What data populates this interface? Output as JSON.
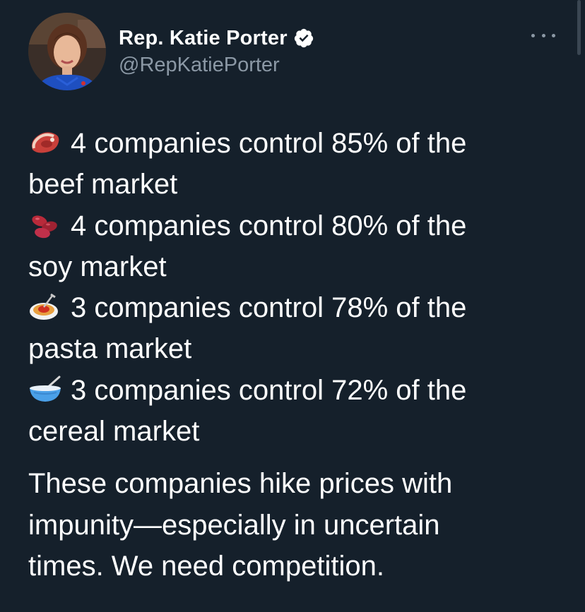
{
  "author": {
    "display_name": "Rep. Katie Porter",
    "handle": "@RepKatiePorter",
    "verified": true
  },
  "icons": {
    "avatar": "profile-photo-icon",
    "verified": "verified-badge-icon",
    "more": "more-options-icon"
  },
  "colors": {
    "background": "#15202b",
    "text": "#ffffff",
    "secondary_text": "#8b98a5"
  },
  "tweet": {
    "lines": [
      {
        "emoji": "meat-icon",
        "text": "4 companies control 85% of the"
      },
      {
        "emoji": "",
        "text": "beef market"
      },
      {
        "emoji": "beans-icon",
        "text": "4 companies control 80% of the"
      },
      {
        "emoji": "",
        "text": "soy market"
      },
      {
        "emoji": "spaghetti-icon",
        "text": "3 companies control 78% of the"
      },
      {
        "emoji": "",
        "text": "pasta market"
      },
      {
        "emoji": "bowl-with-spoon-icon",
        "text": "3 companies control 72% of the"
      },
      {
        "emoji": "",
        "text": "cereal market"
      }
    ],
    "closing_lines": [
      "These companies hike prices with",
      "impunity—especially in uncertain",
      "times. We need competition."
    ]
  }
}
